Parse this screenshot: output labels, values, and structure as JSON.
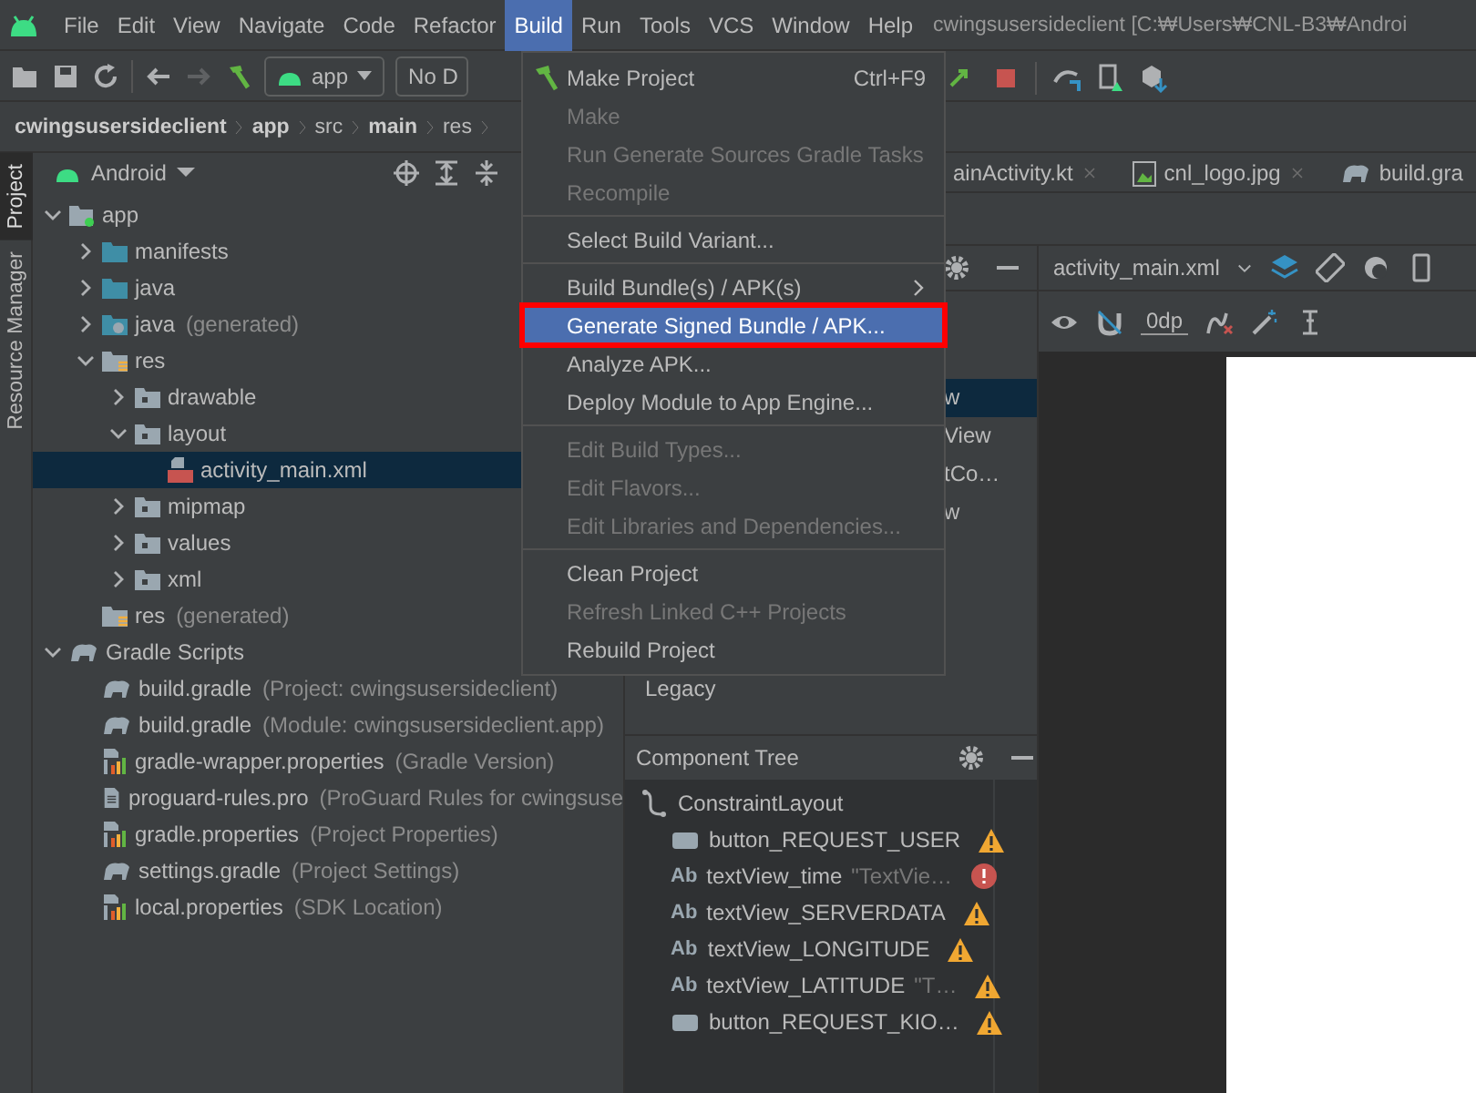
{
  "menu_bar": {
    "items": [
      {
        "label": "File",
        "selected": false
      },
      {
        "label": "Edit",
        "selected": false
      },
      {
        "label": "View",
        "selected": false
      },
      {
        "label": "Navigate",
        "selected": false
      },
      {
        "label": "Code",
        "selected": false
      },
      {
        "label": "Refactor",
        "selected": false
      },
      {
        "label": "Build",
        "selected": true
      },
      {
        "label": "Run",
        "selected": false
      },
      {
        "label": "Tools",
        "selected": false
      },
      {
        "label": "VCS",
        "selected": false
      },
      {
        "label": "Window",
        "selected": false
      },
      {
        "label": "Help",
        "selected": false
      }
    ],
    "title": "cwingsusersideclient [C:₩Users₩CNL-B3₩Androi"
  },
  "toolbar": {
    "run_config": "app",
    "device": "No D"
  },
  "breadcrumb": [
    {
      "label": "cwingsusersideclient",
      "bold": true
    },
    {
      "label": "app",
      "bold": true
    },
    {
      "label": "src",
      "bold": false
    },
    {
      "label": "main",
      "bold": true
    },
    {
      "label": "res",
      "bold": false
    }
  ],
  "side_tabs": [
    {
      "label": "Project",
      "selected": true
    },
    {
      "label": "Resource Manager",
      "selected": false
    }
  ],
  "project": {
    "view": "Android",
    "tree": [
      {
        "label": "app",
        "kind": "module",
        "expanded": true,
        "selected": false,
        "children": [
          {
            "label": "manifests",
            "kind": "folder",
            "expanded": false,
            "selected": false
          },
          {
            "label": "java",
            "kind": "folder",
            "expanded": false,
            "selected": false
          },
          {
            "label": "java",
            "note": "(generated)",
            "kind": "generated",
            "expanded": false,
            "selected": false
          },
          {
            "label": "res",
            "kind": "resources",
            "expanded": true,
            "selected": false,
            "children": [
              {
                "label": "drawable",
                "kind": "directory",
                "expanded": false,
                "selected": false
              },
              {
                "label": "layout",
                "kind": "directory",
                "expanded": true,
                "selected": false,
                "children": [
                  {
                    "label": "activity_main.xml",
                    "kind": "layout",
                    "selected": true
                  }
                ]
              },
              {
                "label": "mipmap",
                "kind": "directory",
                "expanded": false,
                "selected": false
              },
              {
                "label": "values",
                "kind": "directory",
                "expanded": false,
                "selected": false
              },
              {
                "label": "xml",
                "kind": "directory",
                "expanded": false,
                "selected": false
              }
            ]
          },
          {
            "label": "res",
            "note": "(generated)",
            "kind": "resources",
            "selected": false
          }
        ]
      },
      {
        "label": "Gradle Scripts",
        "kind": "gradle",
        "expanded": true,
        "selected": false,
        "children": [
          {
            "label": "build.gradle",
            "note": "(Project: cwingsusersideclient)",
            "kind": "gradle",
            "selected": false
          },
          {
            "label": "build.gradle",
            "note": "(Module: cwingsusersideclient.app)",
            "kind": "gradle",
            "selected": false
          },
          {
            "label": "gradle-wrapper.properties",
            "note": "(Gradle Version)",
            "kind": "properties",
            "selected": false
          },
          {
            "label": "proguard-rules.pro",
            "note": "(ProGuard Rules for cwingsuse",
            "kind": "text",
            "selected": false
          },
          {
            "label": "gradle.properties",
            "note": "(Project Properties)",
            "kind": "properties",
            "selected": false
          },
          {
            "label": "settings.gradle",
            "note": "(Project Settings)",
            "kind": "gradle",
            "selected": false
          },
          {
            "label": "local.properties",
            "note": "(SDK Location)",
            "kind": "properties",
            "selected": false
          }
        ]
      }
    ]
  },
  "editor_tabs": [
    {
      "label": "ainActivity.kt",
      "closable": true
    },
    {
      "label": "cnl_logo.jpg",
      "kind": "image",
      "closable": true
    },
    {
      "label": "build.gra",
      "kind": "gradle",
      "closable": false
    }
  ],
  "palette": {
    "categories": [
      {
        "label": "Legacy"
      }
    ],
    "widgets": [
      {
        "label": "w",
        "selected": true
      },
      {
        "label": "View",
        "selected": false
      },
      {
        "label": "tCo…",
        "selected": false
      },
      {
        "label": "w",
        "selected": false
      }
    ]
  },
  "design": {
    "file": "activity_main.xml",
    "margin": "0dp"
  },
  "component_tree": {
    "title": "Component Tree",
    "root": "ConstraintLayout",
    "items": [
      {
        "kind": "button",
        "label": "button_REQUEST_USER",
        "warning": true,
        "error": false
      },
      {
        "kind": "text",
        "badge": "Ab",
        "label": "textView_time",
        "hint": "\"TextVie…",
        "warning": false,
        "error": true
      },
      {
        "kind": "text",
        "badge": "Ab",
        "label": "textView_SERVERDATA",
        "warning": true,
        "error": false
      },
      {
        "kind": "text",
        "badge": "Ab",
        "label": "textView_LONGITUDE",
        "warning": true,
        "error": false
      },
      {
        "kind": "text",
        "badge": "Ab",
        "label": "textView_LATITUDE",
        "hint": "\"T…",
        "warning": true,
        "error": false
      },
      {
        "kind": "button",
        "label": "button_REQUEST_KIO…",
        "warning": true,
        "error": false
      }
    ]
  },
  "build_menu": {
    "groups": [
      {
        "items": [
          {
            "label": "Make Project",
            "kind": "build",
            "shortcut": "Ctrl+F9",
            "disabled": false,
            "selected": false,
            "submenu": false
          },
          {
            "label": "Make",
            "disabled": true,
            "selected": false,
            "submenu": false
          },
          {
            "label": "Run Generate Sources Gradle Tasks",
            "disabled": true,
            "selected": false,
            "submenu": false
          },
          {
            "label": "Recompile",
            "disabled": true,
            "selected": false,
            "submenu": false
          }
        ]
      },
      {
        "items": [
          {
            "label": "Select Build Variant...",
            "disabled": false,
            "selected": false,
            "submenu": false
          }
        ]
      },
      {
        "items": [
          {
            "label": "Build Bundle(s) / APK(s)",
            "disabled": false,
            "selected": false,
            "submenu": true
          },
          {
            "label": "Generate Signed Bundle / APK...",
            "disabled": false,
            "selected": true,
            "submenu": false
          },
          {
            "label": "Analyze APK...",
            "disabled": false,
            "selected": false,
            "submenu": false
          },
          {
            "label": "Deploy Module to App Engine...",
            "disabled": false,
            "selected": false,
            "submenu": false
          }
        ]
      },
      {
        "items": [
          {
            "label": "Edit Build Types...",
            "disabled": true,
            "selected": false,
            "submenu": false
          },
          {
            "label": "Edit Flavors...",
            "disabled": true,
            "selected": false,
            "submenu": false
          },
          {
            "label": "Edit Libraries and Dependencies...",
            "disabled": true,
            "selected": false,
            "submenu": false
          }
        ]
      },
      {
        "items": [
          {
            "label": "Clean Project",
            "disabled": false,
            "selected": false,
            "submenu": false
          },
          {
            "label": "Refresh Linked C++ Projects",
            "disabled": true,
            "selected": false,
            "submenu": false
          },
          {
            "label": "Rebuild Project",
            "disabled": false,
            "selected": false,
            "submenu": false
          }
        ]
      }
    ]
  }
}
